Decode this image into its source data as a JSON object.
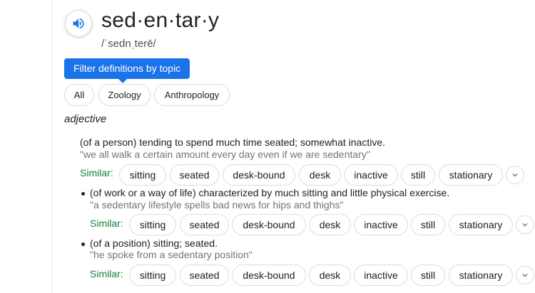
{
  "entry": {
    "headword": "sed·en·tar·y",
    "phonetic": "/ˈsednˌterē/",
    "part_of_speech": "adjective"
  },
  "filter": {
    "tooltip": "Filter definitions by topic",
    "chips": [
      "All",
      "Zoology",
      "Anthropology"
    ]
  },
  "senses": [
    {
      "definition": "(of a person) tending to spend much time seated; somewhat inactive.",
      "example": "\"we all walk a certain amount every day even if we are sedentary\"",
      "similar_label": "Similar:",
      "similar": [
        "sitting",
        "seated",
        "desk-bound",
        "desk",
        "inactive",
        "still",
        "stationary"
      ]
    },
    {
      "definition": "(of work or a way of life) characterized by much sitting and little physical exercise.",
      "example": "\"a sedentary lifestyle spells bad news for hips and thighs\"",
      "similar_label": "Similar:",
      "similar": [
        "sitting",
        "seated",
        "desk-bound",
        "desk",
        "inactive",
        "still",
        "stationary"
      ]
    },
    {
      "definition": "(of a position) sitting; seated.",
      "example": "\"he spoke from a sedentary position\"",
      "similar_label": "Similar:",
      "similar": [
        "sitting",
        "seated",
        "desk-bound",
        "desk",
        "inactive",
        "still",
        "stationary"
      ]
    }
  ],
  "colors": {
    "accent": "#1a73e8",
    "similar_label": "#188038",
    "example_text": "#70757a",
    "chip_border": "#dadce0"
  }
}
